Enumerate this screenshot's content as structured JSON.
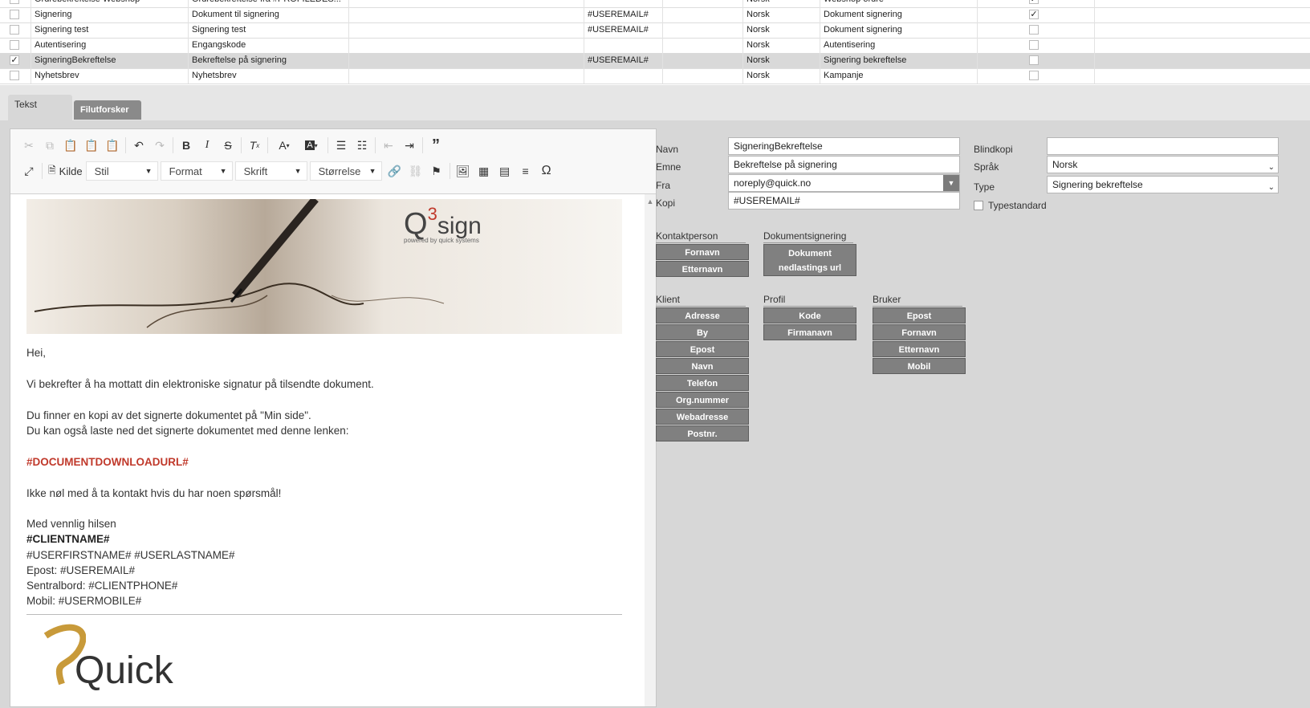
{
  "grid": {
    "rows": [
      {
        "name": "Ordrebekreftelse Webshop",
        "subject": "Ordrebekreftelse fra #PROFILEDES...",
        "sender": "",
        "copy": "",
        "lang": "Norsk",
        "type": "Webshop ordre",
        "checked": false,
        "standard": true
      },
      {
        "name": "Signering",
        "subject": "Dokument til signering",
        "sender": "",
        "copy": "#USEREMAIL#",
        "lang": "Norsk",
        "type": "Dokument signering",
        "checked": false,
        "standard": true
      },
      {
        "name": "Signering test",
        "subject": "Signering test",
        "sender": "",
        "copy": "#USEREMAIL#",
        "lang": "Norsk",
        "type": "Dokument signering",
        "checked": false,
        "standard": false
      },
      {
        "name": "Autentisering",
        "subject": "Engangskode",
        "sender": "",
        "copy": "",
        "lang": "Norsk",
        "type": "Autentisering",
        "checked": false,
        "standard": false
      },
      {
        "name": "SigneringBekreftelse",
        "subject": "Bekreftelse på signering",
        "sender": "",
        "copy": "#USEREMAIL#",
        "lang": "Norsk",
        "type": "Signering bekreftelse",
        "checked": true,
        "standard": false
      },
      {
        "name": "Nyhetsbrev",
        "subject": "Nyhetsbrev",
        "sender": "",
        "copy": "",
        "lang": "Norsk",
        "type": "Kampanje",
        "checked": false,
        "standard": false
      }
    ],
    "check_mark": "✓"
  },
  "tabs": {
    "text": "Tekst",
    "files": "Filutforsker"
  },
  "toolbar": {
    "source_label": "Kilde",
    "style_label": "Stil",
    "format_label": "Format",
    "font_label": "Skrift",
    "size_label": "Størrelse"
  },
  "banner": {
    "logo_text": "Q",
    "logo_sup": "3",
    "logo_sign": "sign",
    "logo_tagline": "powered by quick systems"
  },
  "email": {
    "greeting": "Hei,",
    "line1": "Vi bekrefter å ha mottatt din elektroniske signatur på tilsendte dokument.",
    "line2": "Du finner en kopi av det signerte dokumentet på \"Min side\".",
    "line3": "Du kan også laste ned det signerte dokumentet med denne lenken:",
    "download_placeholder": "#DOCUMENTDOWNLOADURL#",
    "line4": "Ikke nøl med å ta kontakt hvis du har noen spørsmål!",
    "regards": "Med vennlig hilsen",
    "client_name": "#CLIENTNAME#",
    "user_name": "#USERFIRSTNAME# #USERLASTNAME#",
    "epost": "Epost: #USEREMAIL#",
    "phone": "Sentralbord: #CLIENTPHONE#",
    "mobile": "Mobil: #USERMOBILE#",
    "footer_logo": "Quick"
  },
  "form": {
    "navn_label": "Navn",
    "navn_value": "SigneringBekreftelse",
    "emne_label": "Emne",
    "emne_value": "Bekreftelse på signering",
    "fra_label": "Fra",
    "fra_value": "noreply@quick.no",
    "kopi_label": "Kopi",
    "kopi_value": "#USEREMAIL#",
    "blindkopi_label": "Blindkopi",
    "blindkopi_value": "",
    "sprak_label": "Språk",
    "sprak_value": "Norsk",
    "type_label": "Type",
    "type_value": "Signering bekreftelse",
    "typestandard_label": "Typestandard"
  },
  "groups": {
    "kontakt": {
      "title": "Kontaktperson",
      "items": [
        "Fornavn",
        "Etternavn"
      ]
    },
    "dok": {
      "title": "Dokumentsignering",
      "items": [
        "Dokument nedlastings url"
      ]
    },
    "klient": {
      "title": "Klient",
      "items": [
        "Adresse",
        "By",
        "Epost",
        "Navn",
        "Telefon",
        "Org.nummer",
        "Webadresse",
        "Postnr."
      ]
    },
    "profil": {
      "title": "Profil",
      "items": [
        "Kode",
        "Firmanavn"
      ]
    },
    "bruker": {
      "title": "Bruker",
      "items": [
        "Epost",
        "Fornavn",
        "Etternavn",
        "Mobil"
      ]
    }
  }
}
